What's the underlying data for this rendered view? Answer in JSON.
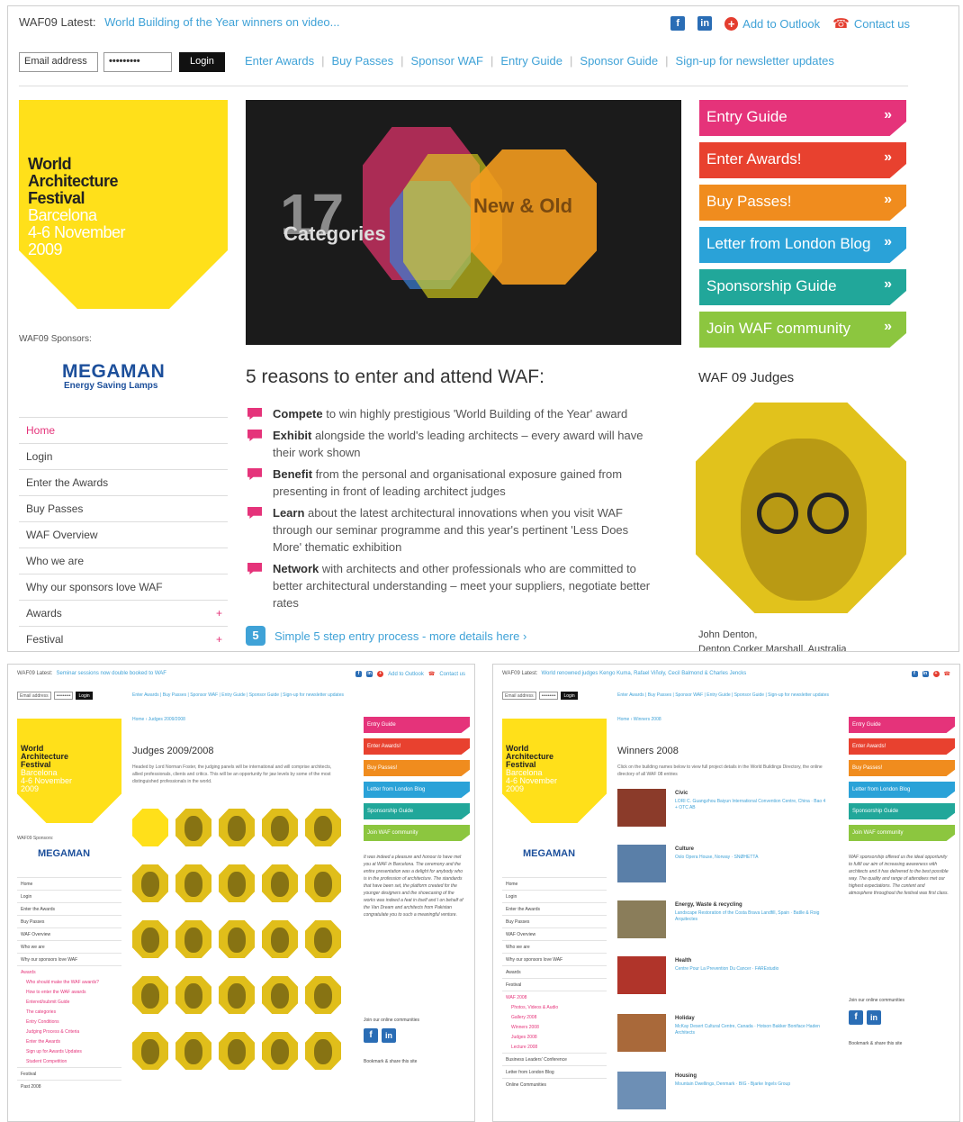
{
  "main": {
    "latest_label": "WAF09 Latest:",
    "latest_text": "World Building of the Year winners on video...",
    "outlook": "Add to Outlook",
    "contact": "Contact us",
    "email_placeholder": "Email address",
    "password_value": "•••••••••",
    "login_btn": "Login",
    "nav": [
      "Enter Awards",
      "Buy Passes",
      "Sponsor WAF",
      "Entry Guide",
      "Sponsor Guide",
      "Sign-up for newsletter updates"
    ],
    "logo": {
      "l1": "World",
      "l2": "Architecture",
      "l3": "Festival",
      "l4": "Barcelona",
      "l5": "4-6 November",
      "l6": "2009"
    },
    "sponsors_label": "WAF09 Sponsors:",
    "sponsor_name": "MEGAMAN",
    "sponsor_sub": "Energy Saving Lamps",
    "left_nav": [
      {
        "label": "Home",
        "active": true
      },
      {
        "label": "Login"
      },
      {
        "label": "Enter the Awards"
      },
      {
        "label": "Buy Passes"
      },
      {
        "label": "WAF Overview"
      },
      {
        "label": "Who we are"
      },
      {
        "label": "Why our sponsors love WAF"
      },
      {
        "label": "Awards",
        "plus": "+"
      },
      {
        "label": "Festival",
        "plus": "+"
      }
    ],
    "hero": {
      "number": "17",
      "caption": "Categories",
      "tag": "New & Old"
    },
    "right_buttons": [
      {
        "label": "Entry Guide",
        "color": "#e5337a"
      },
      {
        "label": "Enter Awards!",
        "color": "#e8412f"
      },
      {
        "label": "Buy Passes!",
        "color": "#f08c1e"
      },
      {
        "label": "Letter from London Blog",
        "color": "#2aa2d8"
      },
      {
        "label": "Sponsorship Guide",
        "color": "#21a79a"
      },
      {
        "label": "Join WAF community",
        "color": "#8cc63f"
      }
    ],
    "arrow": "»",
    "reasons_title": "5 reasons to enter and attend WAF:",
    "reasons": [
      {
        "bold": "Compete",
        "text": " to win highly prestigious 'World Building of the Year' award"
      },
      {
        "bold": "Exhibit",
        "text": " alongside the world's leading architects – every award will have their work shown"
      },
      {
        "bold": "Benefit",
        "text": " from the personal and organisational exposure gained from presenting in front of leading architect judges"
      },
      {
        "bold": "Learn",
        "text": " about the latest architectural innovations when you visit WAF through our seminar programme and this year's pertinent 'Less Does More' thematic exhibition"
      },
      {
        "bold": "Network",
        "text": " with architects and other professionals who are committed to better architectural understanding – meet your suppliers, negotiate better rates"
      }
    ],
    "steps_num": "5",
    "steps_text": "Simple 5 step entry process - more details here ›",
    "judges_title": "WAF 09 Judges",
    "judge_name": "John Denton,",
    "judge_firm": "Denton Corker Marshall, Australia"
  },
  "mini1": {
    "latest_label": "WAF09 Latest:",
    "latest_text": "Seminar sessions now double booked to WAF",
    "crumb": "Home › Judges 2009/2008",
    "title": "Judges 2009/2008",
    "intro": "Headed by Lord Norman Foster, the judging panels will be international and will comprise architects, allied professionals, clients and critics. This will be an opportunity for jaw levels by some of the most distinguished professionals in the world.",
    "left_nav": [
      "Home",
      "Login",
      "Enter the Awards",
      "Buy Passes",
      "WAF Overview",
      "Who we are",
      "Why our sponsors love WAF",
      "Awards"
    ],
    "sub_nav": [
      "Who should make the WAF awards?",
      "How to enter the WAF awards",
      "Entered/submit Guide",
      "The categories",
      "Entry Conditions",
      "Judging Process & Criteria",
      "Enter the Awards",
      "Sign up for Awards Updates",
      "Student Competition"
    ],
    "tail_nav": [
      "Festival",
      "Past 2008"
    ],
    "quote": "It was indeed a pleasure and honour to have met you at WAF in Barcelona. The ceremony and the entire presentation was a delight for anybody who is in the profession of architecture. The standards that have been set, the platform created for the younger designers and the showcasing of the works was indeed a feat in itself and I on behalf of the Van Dream and architects from Pakistan congratulate you to such a meaningful venture.",
    "join": "Join our online communities",
    "bookmark": "Bookmark & share this site"
  },
  "mini2": {
    "latest_label": "WAF09 Latest:",
    "latest_text": "World renowned judges Kengo Kuma, Rafael Viñoly, Cecil Balmond & Charles Jencks",
    "crumb": "Home › Winners 2008",
    "title": "Winners 2008",
    "intro": "Click on the building names below to view full project details in the World Buildings Directory, the online directory of all WAF 08 entries",
    "winners": [
      {
        "cat": "Civic",
        "desc": "LORI C. Guangzhou Baiyun International Convention Centre, China · Bao 4 + OTC AB",
        "color": "#8b3b2a"
      },
      {
        "cat": "Culture",
        "desc": "Oslo Opera House, Norway · SNØHETTA",
        "color": "#5a7fa8"
      },
      {
        "cat": "Energy, Waste & recycling",
        "desc": "Landscape Restoration of the Costa Brava Landfill, Spain · Batlle & Roig Arquitectes",
        "color": "#8a7d5a"
      },
      {
        "cat": "Health",
        "desc": "Centre Pour La Prevention Du Cancer · FAREstudio",
        "color": "#b0342a"
      },
      {
        "cat": "Holiday",
        "desc": "McKay Desert Cultural Centre, Canada · Hotson Bakker Boniface Haden Architects",
        "color": "#a9693a"
      },
      {
        "cat": "Housing",
        "desc": "Mountain Dwellings, Denmark · BIG - Bjarke Ingels Group",
        "color": "#6d8fb5"
      }
    ],
    "left_nav": [
      "Home",
      "Login",
      "Enter the Awards",
      "Buy Passes",
      "WAF Overview",
      "Who we are",
      "Why our sponsors love WAF",
      "Awards",
      "Festival",
      "WAF 2008"
    ],
    "sub_nav": [
      "Photos, Videos & Audio",
      "Gallery 2008",
      "Winners 2008",
      "Judges 2008",
      "Lecture 2008"
    ],
    "tail_nav": [
      "Business Leaders' Conference",
      "Letter from London Blog",
      "Online Communities"
    ],
    "quote": "WAF sponsorship offered us the ideal opportunity to fulfil our aim of increasing awareness with architects and it has delivered to the best possible way. The quality and range of attendees met our highest expectations. The content and atmosphere throughout the festival was first class.",
    "join": "Join our online communities",
    "bookmark": "Bookmark & share this site"
  }
}
